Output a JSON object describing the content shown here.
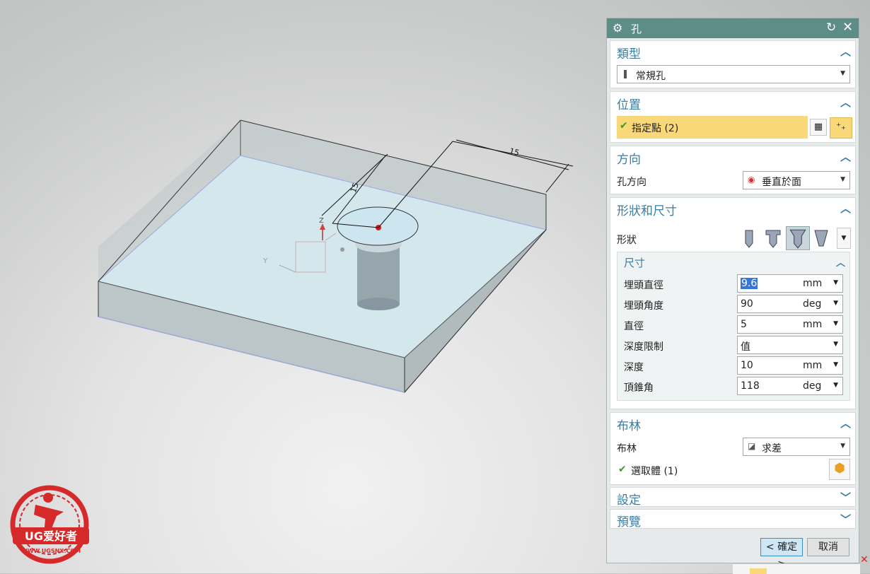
{
  "viewport": {
    "dimensions": [
      "15",
      "15"
    ],
    "axis_label": "Z",
    "axis_label_y": "Y"
  },
  "dialog": {
    "title": "孔",
    "sections": {
      "type": {
        "title": "類型",
        "value": "常規孔"
      },
      "position": {
        "title": "位置",
        "specify_point": "指定點 (2)"
      },
      "direction": {
        "title": "方向",
        "label": "孔方向",
        "value": "垂直於面"
      },
      "shape_size": {
        "title": "形狀和尺寸",
        "shape_label": "形狀",
        "dims_title": "尺寸",
        "rows": [
          {
            "name": "埋頭直徑",
            "value": "9.6",
            "unit": "mm"
          },
          {
            "name": "埋頭角度",
            "value": "90",
            "unit": "deg"
          },
          {
            "name": "直徑",
            "value": "5",
            "unit": "mm"
          },
          {
            "name": "深度限制",
            "value": "值",
            "unit": ""
          },
          {
            "name": "深度",
            "value": "10",
            "unit": "mm"
          },
          {
            "name": "頂錐角",
            "value": "118",
            "unit": "deg"
          }
        ]
      },
      "boolean": {
        "title": "布林",
        "label": "布林",
        "value": "求差",
        "select_body": "選取體 (1)"
      },
      "settings": {
        "title": "設定"
      },
      "preview": {
        "title": "預覽"
      }
    },
    "buttons": {
      "ok": "< 確定 >",
      "cancel": "取消"
    }
  },
  "logo": {
    "text": "UG爱好者",
    "url": "WWW.UGSNX.COM"
  },
  "colors": {
    "accent": "#3a7ea4",
    "titlebar": "#5e8d88",
    "highlight": "#f8d878"
  }
}
